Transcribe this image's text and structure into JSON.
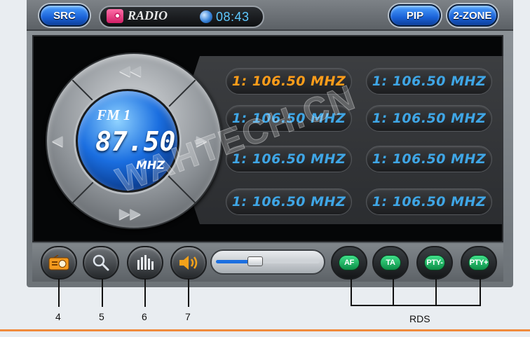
{
  "topbar": {
    "src_label": "SRC",
    "source_title": "RADIO",
    "clock": "08:43",
    "pip_label": "PIP",
    "zone_label": "2-ZONE"
  },
  "dial": {
    "band": "FM 1",
    "frequency": "87.50",
    "unit": "MHZ",
    "prev_icon": "skip-previous-icon",
    "next_icon": "skip-next-icon",
    "seek_back_icon": "seek-back-icon",
    "seek_forward_icon": "seek-forward-icon"
  },
  "presets": [
    {
      "label": "1: 106.50 MHZ",
      "active": true
    },
    {
      "label": "1: 106.50 MHZ",
      "active": false
    },
    {
      "label": "1: 106.50 MHZ",
      "active": false
    },
    {
      "label": "1: 106.50 MHZ",
      "active": false
    },
    {
      "label": "1: 106.50 MHZ",
      "active": false
    },
    {
      "label": "1: 106.50 MHZ",
      "active": false
    },
    {
      "label": "1: 106.50 MHZ",
      "active": false
    },
    {
      "label": "1: 106.50 MHZ",
      "active": false
    }
  ],
  "controls": {
    "radio_icon": "radio-icon",
    "search_icon": "search-icon",
    "eq_icon": "equalizer-icon",
    "volume_icon": "speaker-icon",
    "volume_level": 0.38
  },
  "rds": {
    "af": "AF",
    "ta": "TA",
    "pty_minus": "PTY-",
    "pty_plus": "PTY+"
  },
  "callouts": {
    "n4": "4",
    "n5": "5",
    "n6": "6",
    "n7": "7",
    "rds": "RDS"
  },
  "watermark": "WAHTECH.CN",
  "colors": {
    "accent_blue": "#1a62d8",
    "preset_text": "#3fa6e6",
    "preset_active": "#ff9d1a",
    "rds_green": "#0c8d46",
    "rule_orange": "#f08a3c"
  }
}
